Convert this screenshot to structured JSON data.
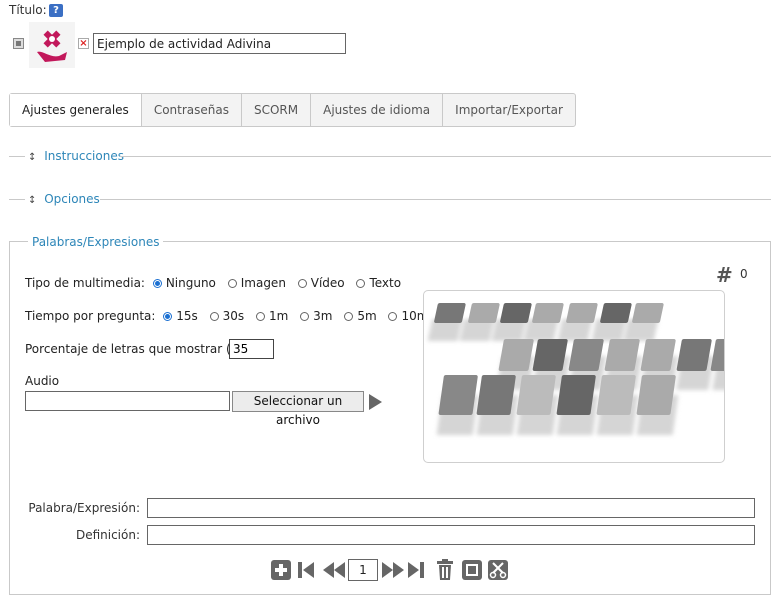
{
  "header": {
    "title_label": "Título:",
    "help_icon": "question-icon",
    "title_value": "Ejemplo de actividad Adivina"
  },
  "tabs": [
    {
      "label": "Ajustes generales",
      "active": true
    },
    {
      "label": "Contraseñas",
      "active": false
    },
    {
      "label": "SCORM",
      "active": false
    },
    {
      "label": "Ajustes de idioma",
      "active": false
    },
    {
      "label": "Importar/Exportar",
      "active": false
    }
  ],
  "sections": {
    "instructions": "Instrucciones",
    "options": "Opciones",
    "words": "Palabras/Expresiones"
  },
  "form": {
    "media_label": "Tipo de multimedia:",
    "media_options": [
      "Ninguno",
      "Imagen",
      "Vídeo",
      "Texto"
    ],
    "media_selected": "Ninguno",
    "time_label": "Tiempo por pregunta:",
    "time_options": [
      "15s",
      "30s",
      "1m",
      "3m",
      "5m",
      "10m"
    ],
    "time_selected": "15s",
    "percent_label": "Porcentaje de letras que mostrar (%):",
    "percent_value": "35",
    "audio_label": "Audio",
    "audio_value": "",
    "select_file": "Seleccionar un archivo",
    "count_symbol": "#",
    "count_value": "0",
    "word_label": "Palabra/Expresión:",
    "definition_label": "Definición:",
    "page_number": "1"
  },
  "colors": {
    "accent": "#2d86b8",
    "radio": "#1a6fd1",
    "icon": "#666666"
  }
}
